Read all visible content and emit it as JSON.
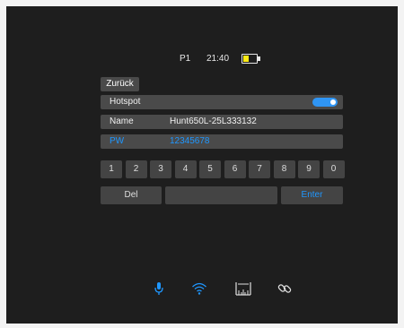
{
  "status": {
    "profile": "P1",
    "time": "21:40",
    "battery_level": 0.4,
    "battery_color": "#ffeb14"
  },
  "back_label": "Zurück",
  "hotspot": {
    "label": "Hotspot",
    "enabled": true,
    "toggle_color": "#2f95f4"
  },
  "name": {
    "label": "Name",
    "value": "Hunt650L-25L333132"
  },
  "password": {
    "label": "PW",
    "value": "12345678",
    "color": "#1f97ff"
  },
  "keypad": {
    "digits": [
      "1",
      "2",
      "3",
      "4",
      "5",
      "6",
      "7",
      "8",
      "9",
      "0"
    ],
    "del_label": "Del",
    "space_label": "",
    "enter_label": "Enter"
  },
  "bottom_bar": {
    "icons": [
      "microphone-icon",
      "wifi-icon",
      "ruler-icon",
      "link-icon"
    ],
    "accent": "#1f97ff"
  }
}
